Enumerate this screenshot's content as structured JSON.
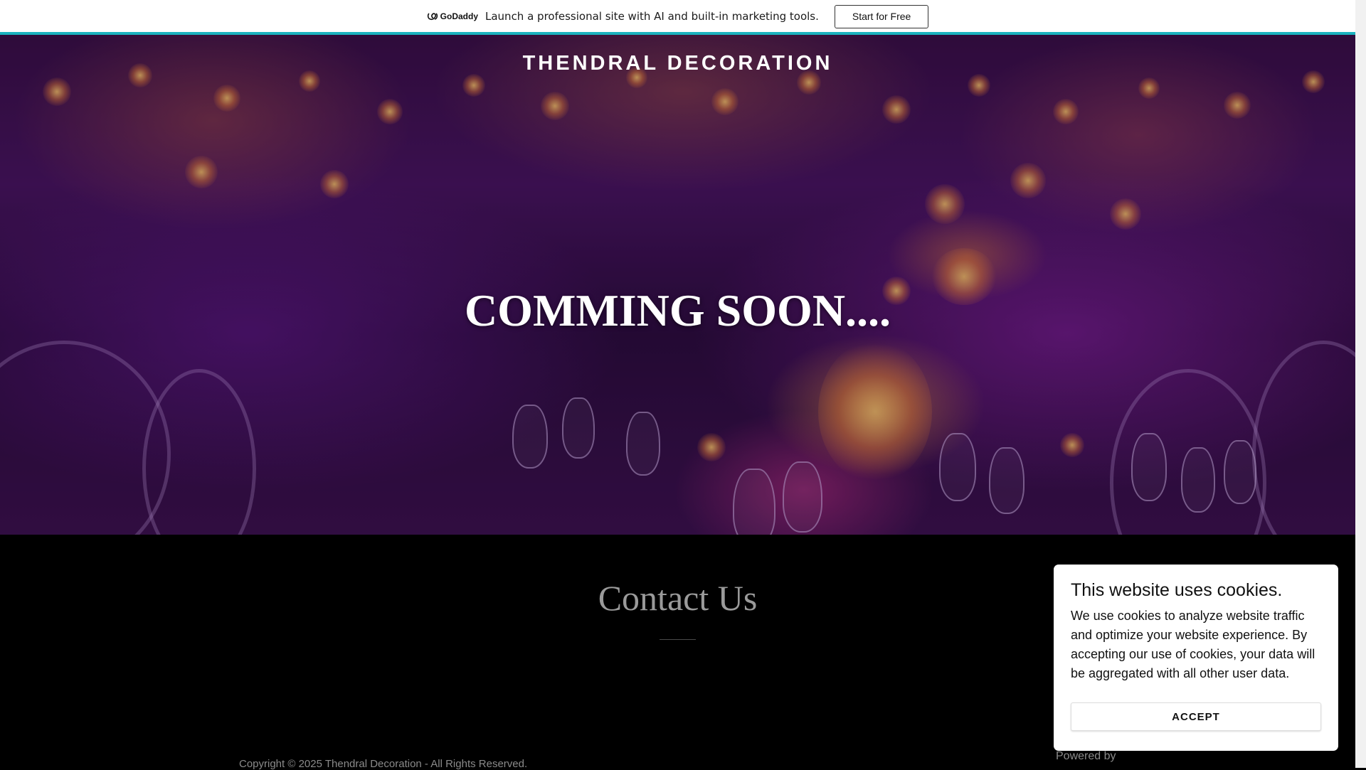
{
  "promo": {
    "logo_text": "GoDaddy",
    "message": "Launch a professional site with AI and built-in marketing tools.",
    "button_label": "Start for Free"
  },
  "hero": {
    "site_title": "THENDRAL DECORATION",
    "heading": "COMMING SOON...."
  },
  "contact": {
    "heading": "Contact Us"
  },
  "footer": {
    "copyright": "Copyright © 2025 Thendral Decoration - All Rights Reserved.",
    "powered_by": "Powered by"
  },
  "cookie_banner": {
    "title": "This website uses cookies.",
    "body": "We use cookies to analyze website traffic and optimize your website experience. By accepting our use of cookies, your data will be aggregated with all other user data.",
    "accept_label": "ACCEPT"
  },
  "colors": {
    "accent": "#1bb3bf",
    "background": "#000000",
    "muted_text": "#9a9a9a"
  }
}
